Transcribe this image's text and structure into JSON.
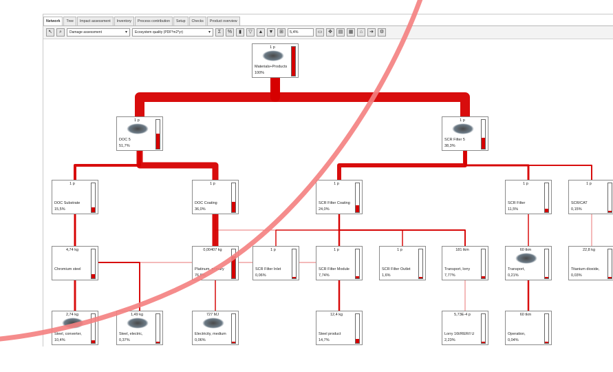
{
  "tabs": [
    "Network",
    "Tree",
    "Impact assessment",
    "Inventory",
    "Process contribution",
    "Setup",
    "Checks",
    "Product overview"
  ],
  "active_tab_index": 0,
  "toolbar": {
    "method_select": "Damage assessment",
    "category_select": "Ecosystem quality (PDF*m2*yr)",
    "zoom": "5,4%"
  },
  "colors": {
    "flow": "#d60000",
    "annotation": "#f48080"
  },
  "icons": [
    "select-arrow-icon",
    "zoom-icon",
    "sum-icon",
    "percent-icon",
    "chart-icon",
    "filter-icon",
    "filter-up-icon",
    "filter-down-icon",
    "network-icon",
    "window-icon",
    "move-icon",
    "layout-icon",
    "grid-icon",
    "home-icon",
    "forward-icon",
    "settings-icon"
  ],
  "nodes": {
    "root": {
      "amount": "1 p",
      "name": "Materials+Products",
      "pct": "100%",
      "level": 1.0
    },
    "doc": {
      "amount": "1 p",
      "name": "DOC 5",
      "pct": "51,7%",
      "level": 0.52
    },
    "scr": {
      "amount": "1 p",
      "name": "SCR Filter 5",
      "pct": "38,3%",
      "level": 0.38
    },
    "docsub": {
      "amount": "1 p",
      "name": "DOC Substrate",
      "pct": "15,5%",
      "level": 0.16
    },
    "doccoat": {
      "amount": "1 p",
      "name": "DOC Coating",
      "pct": "36,0%",
      "level": 0.36
    },
    "scrcoat": {
      "amount": "1 p",
      "name": "SCR Filter Coating",
      "pct": "24,0%",
      "level": 0.24
    },
    "scrf": {
      "amount": "1 p",
      "name": "SCR Filter",
      "pct": "11,5%",
      "level": 0.12
    },
    "scrcat": {
      "amount": "1 p",
      "name": "SCR/CAT",
      "pct": "0,15%",
      "level": 0.02
    },
    "crsteel": {
      "amount": "4,74 kg",
      "name": "Chromium steel",
      "pct": "",
      "level": 0.14
    },
    "pt": {
      "amount": "0,00407 kg",
      "name": "Platinum, primary",
      "pct": "76,8%",
      "level": 0.77
    },
    "scrin": {
      "amount": "1 p",
      "name": "SCR Filter Inlet",
      "pct": "0,06%",
      "level": 0.01
    },
    "scrmod": {
      "amount": "1 p",
      "name": "SCR Filter Module",
      "pct": "7,74%",
      "level": 0.08
    },
    "scrout": {
      "amount": "1 p",
      "name": "SCR Filter Outlet",
      "pct": "1,6%",
      "level": 0.02
    },
    "lorry": {
      "amount": "181 tkm",
      "name": "Transport, lorry",
      "pct": "7,77%",
      "level": 0.08
    },
    "transp": {
      "amount": "60 tkm",
      "name": "Transport,",
      "pct": "0,21%",
      "level": 0.02
    },
    "ti": {
      "amount": "22,8 kg",
      "name": "Titanium dioxide,",
      "pct": "0,03%",
      "level": 0.01
    },
    "steel1": {
      "amount": "2,74 kg",
      "name": "Steel, converter,",
      "pct": "10,4%",
      "level": 0.1
    },
    "steel2": {
      "amount": "1,49 kg",
      "name": "Steel, electric,",
      "pct": "0,37%",
      "level": 0.01
    },
    "elec": {
      "amount": "727 MJ",
      "name": "Electricity, medium",
      "pct": "0,06%",
      "level": 0.01
    },
    "steelprod": {
      "amount": "12,4 kg",
      "name": "Steel product",
      "pct": "14,7%",
      "level": 0.15
    },
    "lorryb": {
      "amount": "5,73E-4 p",
      "name": "Lorry 16t/RER/I U",
      "pct": "2,23%",
      "level": 0.02
    },
    "oper": {
      "amount": "60 tkm",
      "name": "Operation,",
      "pct": "0,04%",
      "level": 0.01
    }
  }
}
